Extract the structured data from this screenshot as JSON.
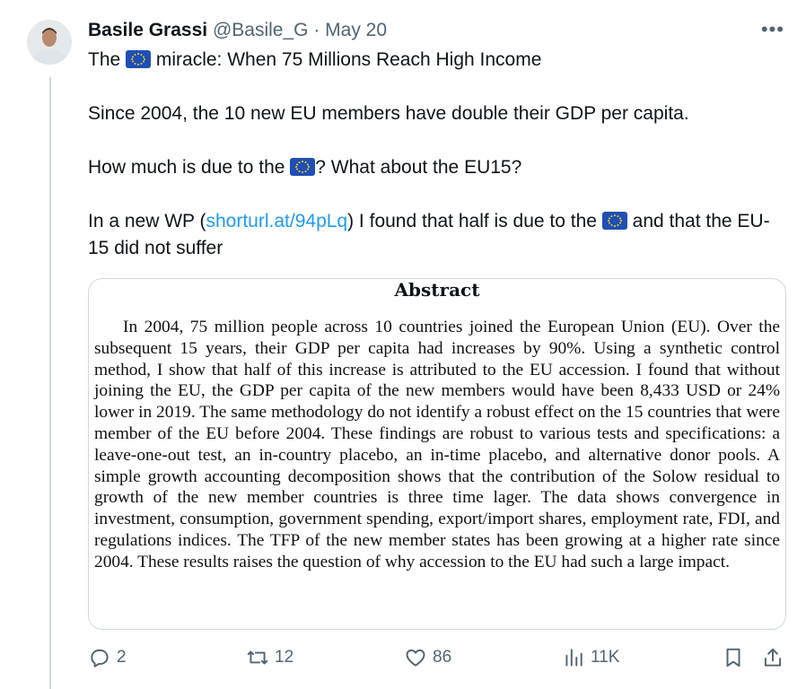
{
  "tweet": {
    "author_name": "Basile Grassi",
    "handle": "@Basile_G",
    "separator": "·",
    "date": "May 20",
    "more_label": "•••",
    "lines": {
      "l1_a": "The",
      "l1_b": "miracle: When 75 Millions Reach High Income",
      "p2": "Since 2004, the 10 new EU members have double their GDP per capita.",
      "p3_a": "How much is due to the",
      "p3_b": "? What about the EU15?",
      "p4_a": "In a new WP (",
      "p4_link": "shorturl.at/94pLq",
      "p4_b": ") I found that half is due to the",
      "p4_c": "and that the EU-15 did not suffer"
    },
    "flag_icon": "eu-flag-icon"
  },
  "abstract": {
    "title": "Abstract",
    "text": "In 2004, 75 million people across 10 countries joined the European Union (EU). Over the subsequent 15 years, their GDP per capita had increases by 90%. Using a synthetic control method, I show that half of this increase is attributed to the EU accession. I found that without joining the EU, the GDP per capita of the new members would have been 8,433 USD or 24% lower in 2019. The same methodology do not identify a robust effect on the 15 countries that were member of the EU before 2004. These findings are robust to various tests and specifications: a leave-one-out test, an in-country placebo, an in-time placebo, and alternative donor pools. A simple growth accounting decomposition shows that the contribution of the Solow residual to growth of the new member countries is three time lager. The data shows convergence in investment, consumption, government spending, export/import shares, employment rate, FDI, and regulations indices. The TFP of the new member states has been growing at a higher rate since 2004. These results raises the question of why accession to the EU had such a large impact."
  },
  "actions": {
    "replies": "2",
    "reposts": "12",
    "likes": "86",
    "views": "11K"
  },
  "colors": {
    "text": "#0f1419",
    "muted": "#536471",
    "link": "#1d9bf0",
    "border": "#cfd9de",
    "eu_blue": "#1f4fb5",
    "eu_star": "#f7d21e"
  }
}
